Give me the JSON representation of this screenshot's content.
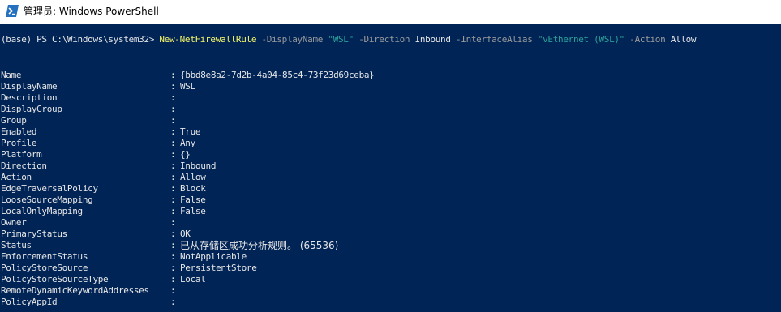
{
  "window": {
    "title": "管理员: Windows PowerShell",
    "icon": "powershell-icon",
    "colors": {
      "background": "#012456",
      "text": "#e6e6e6",
      "cmdlet": "#f6f669",
      "parameter": "#9b9b9b",
      "string": "#2aa198"
    }
  },
  "prompt": {
    "prefix": "(base) PS C:\\Windows\\system32> ",
    "cmdlet": "New-NetFirewallRule",
    "p1_name": " -DisplayName ",
    "p1_value": "\"WSL\"",
    "p2_name": " -Direction ",
    "p2_value": "Inbound",
    "p3_name": " -InterfaceAlias ",
    "p3_value": "\"vEthernet (WSL)\"",
    "p4_name": " -Action ",
    "p4_value": "Allow"
  },
  "output": {
    "separator": ":",
    "rows": [
      {
        "key": "Name",
        "value": "{bbd8e8a2-7d2b-4a04-85c4-73f23d69ceba}"
      },
      {
        "key": "DisplayName",
        "value": "WSL"
      },
      {
        "key": "Description",
        "value": ""
      },
      {
        "key": "DisplayGroup",
        "value": ""
      },
      {
        "key": "Group",
        "value": ""
      },
      {
        "key": "Enabled",
        "value": "True"
      },
      {
        "key": "Profile",
        "value": "Any"
      },
      {
        "key": "Platform",
        "value": "{}"
      },
      {
        "key": "Direction",
        "value": "Inbound"
      },
      {
        "key": "Action",
        "value": "Allow"
      },
      {
        "key": "EdgeTraversalPolicy",
        "value": "Block"
      },
      {
        "key": "LooseSourceMapping",
        "value": "False"
      },
      {
        "key": "LocalOnlyMapping",
        "value": "False"
      },
      {
        "key": "Owner",
        "value": ""
      },
      {
        "key": "PrimaryStatus",
        "value": "OK"
      },
      {
        "key": "Status",
        "value": "已从存储区成功分析规则。 (65536)"
      },
      {
        "key": "EnforcementStatus",
        "value": "NotApplicable"
      },
      {
        "key": "PolicyStoreSource",
        "value": "PersistentStore"
      },
      {
        "key": "PolicyStoreSourceType",
        "value": "Local"
      },
      {
        "key": "RemoteDynamicKeywordAddresses",
        "value": ""
      },
      {
        "key": "PolicyAppId",
        "value": ""
      }
    ]
  }
}
